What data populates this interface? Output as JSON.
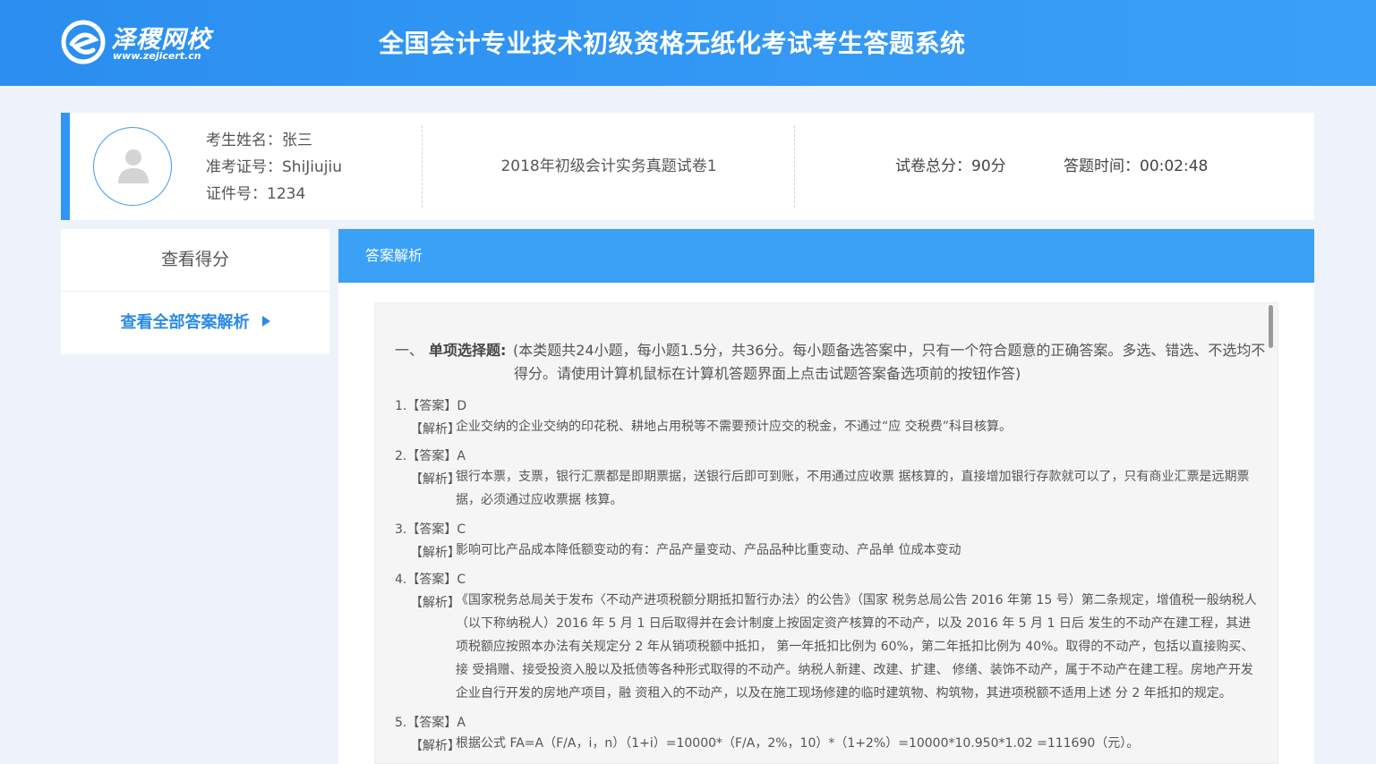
{
  "header": {
    "logo_name": "泽稷网校",
    "logo_url": "www.zejicert.cn",
    "title": "全国会计专业技术初级资格无纸化考试考生答题系统"
  },
  "candidate": {
    "name_label": "考生姓名：",
    "name": "张三",
    "id_label": "准考证号：",
    "id": "ShiJiujiu",
    "cert_label": "证件号：",
    "cert": "1234",
    "exam_name": "2018年初级会计实务真题试卷1",
    "score_label": "试卷总分：",
    "score": "90分",
    "time_label": "答题时间：",
    "time": "00:02:48"
  },
  "sidebar": {
    "title": "查看得分",
    "link": "查看全部答案解析"
  },
  "main": {
    "header": "答案解析",
    "section": {
      "num": "一、",
      "title": "单项选择题:",
      "desc_line1": "(本类题共24小题，每小题1.5分，共36分。每小题备选答案中，只有一个符合题意的正确答案。多选、错选、不选均不",
      "desc_line2": "得分。请使用计算机鼠标在计算机答题界面上点击试题答案备选项前的按钮作答)"
    },
    "questions": [
      {
        "answer": "1.【答案】D",
        "exp_label": "【解析】",
        "exp": "企业交纳的企业交纳的印花税、耕地占用税等不需要预计应交的税金，不通过“应 交税费”科目核算。"
      },
      {
        "answer": "2.【答案】A",
        "exp_label": "【解析】",
        "exp": "银行本票，支票，银行汇票都是即期票据，送银行后即可到账，不用通过应收票 据核算的，直接增加银行存款就可以了，只有商业汇票是远期票据，必须通过应收票据 核算。"
      },
      {
        "answer": "3.【答案】C",
        "exp_label": "【解析】",
        "exp": "影响可比产品成本降低额变动的有：产品产量变动、产品品种比重变动、产品单 位成本变动"
      },
      {
        "answer": "4.【答案】C",
        "exp_label": "【解析】",
        "exp": "《国家税务总局关于发布〈不动产进项税额分期抵扣暂行办法〉的公告》（国家 税务总局公告 2016 年第 15 号）第二条规定，增值税一般纳税人（以下称纳税人）2016 年 5 月 1 日后取得并在会计制度上按固定资产核算的不动产，以及 2016 年 5 月 1 日后 发生的不动产在建工程，其进项税额应按照本办法有关规定分 2 年从销项税额中抵扣， 第一年抵扣比例为 60%，第二年抵扣比例为 40%。取得的不动产，包括以直接购买、接 受捐赠、接受投资入股以及抵债等各种形式取得的不动产。纳税人新建、改建、扩建、 修缮、装饰不动产，属于不动产在建工程。房地产开发企业自行开发的房地产项目，融 资租入的不动产，以及在施工现场修建的临时建筑物、构筑物，其进项税额不适用上述 分 2 年抵扣的规定。"
      },
      {
        "answer": "5.【答案】A",
        "exp_label": "【解析】",
        "exp": "根据公式 FA=A（F/A，i，n）（1+i）=10000*（F/A，2%，10）*（1+2%）=10000*10.950*1.02 =111690（元）。"
      }
    ]
  }
}
